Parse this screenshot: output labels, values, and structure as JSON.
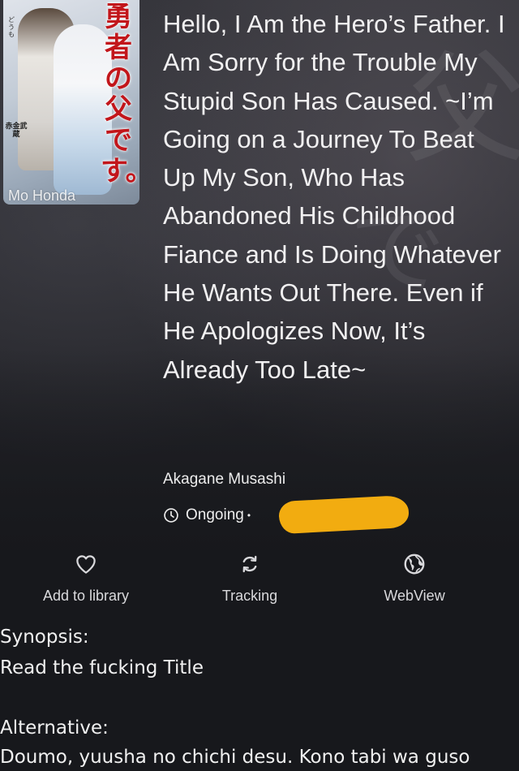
{
  "manga": {
    "title": "Hello, I Am the Hero’s Father. I Am Sorry for the Trouble My Stupid Son Has Caused. ~I’m Going on a Journey To Beat Up My Son, Who Has Abandoned His Childhood Fiance and Is Doing Whatever He Wants Out There. Even if He Apologizes Now, It’s Already Too Late~",
    "author": "Akagane Musashi",
    "status": "Ongoing",
    "status_separator": "•"
  },
  "cover": {
    "title_jp": "勇者の父です。",
    "hiragana_jp": "どうも",
    "author_jp": "赤金武蔵",
    "illustrator": "Mo Honda"
  },
  "actions": {
    "library_label": "Add to library",
    "tracking_label": "Tracking",
    "webview_label": "WebView"
  },
  "details": {
    "synopsis_label": "Synopsis:",
    "synopsis_text": "Read the fucking Title",
    "alternative_label": "Alternative:",
    "alternative_text": " Doumo, yuusha no chichi desu. Kono tabi wa guso"
  },
  "colors": {
    "background": "#17181c",
    "redaction": "#f2ac10",
    "cover_title_red": "#c2161b"
  },
  "icons": {
    "status": "clock-icon",
    "library": "heart-icon",
    "tracking": "sync-icon",
    "webview": "globe-icon"
  }
}
